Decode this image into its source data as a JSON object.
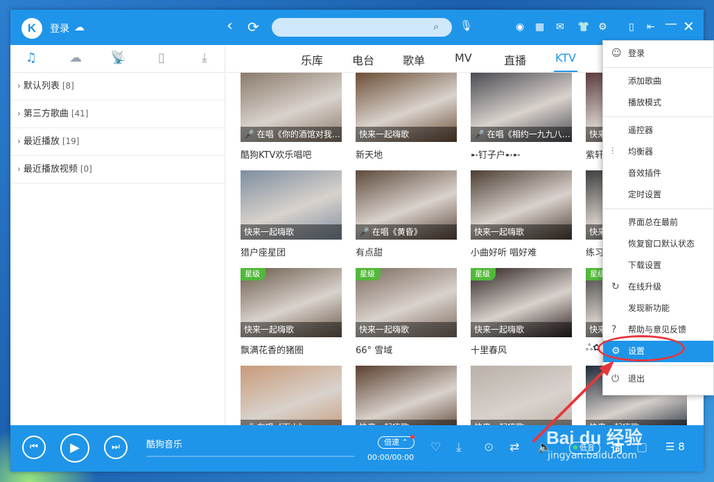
{
  "titlebar": {
    "logo_letter": "K",
    "login": "登录",
    "search": {
      "value": "",
      "placeholder": ""
    }
  },
  "sidebar": {
    "items": [
      {
        "label": "默认列表",
        "count": "[8]"
      },
      {
        "label": "第三方歌曲",
        "count": "[41]"
      },
      {
        "label": "最近播放",
        "count": "[19]"
      },
      {
        "label": "最近播放视频",
        "count": "[0]"
      }
    ]
  },
  "tabs": [
    {
      "label": "乐库"
    },
    {
      "label": "电台"
    },
    {
      "label": "歌单"
    },
    {
      "label": "MV"
    },
    {
      "label": "直播"
    },
    {
      "label": "KTV",
      "active": true
    }
  ],
  "cards": [
    {
      "overlay": "在唱《你的酒馆对我…",
      "mic": true,
      "title": "酷狗KTV欢乐唱吧",
      "star": "",
      "color": "#8a7a6a"
    },
    {
      "overlay": "快来一起嗨歌",
      "mic": false,
      "title": "新天地",
      "star": "",
      "color": "#6b4e36"
    },
    {
      "overlay": "在唱《相约一九九八…",
      "mic": true,
      "title": "➸钉子户➸➸",
      "star": "",
      "color": "#4a4a52"
    },
    {
      "overlay": "快来",
      "mic": false,
      "title": "紫轩",
      "star": "",
      "color": "#5a3a3a"
    },
    {
      "overlay": "快来一起嗨歌",
      "mic": false,
      "title": "猎户座星团",
      "star": "",
      "color": "#7d8ea0"
    },
    {
      "overlay": "在唱《黄昏》",
      "mic": true,
      "title": "有点甜",
      "star": "",
      "color": "#5e4a3c"
    },
    {
      "overlay": "快来一起嗨歌",
      "mic": false,
      "title": "小曲好听 唱好难",
      "star": "",
      "color": "#4c3f34"
    },
    {
      "overlay": "快来",
      "mic": false,
      "title": "练习",
      "star": "",
      "color": "#3d3d3d"
    },
    {
      "overlay": "快来一起嗨歌",
      "mic": false,
      "title": "飘满花香的猪圈",
      "star": "星级",
      "color": "#6a5a4a"
    },
    {
      "overlay": "快来一起嗨歌",
      "mic": false,
      "title": "66° 雪域",
      "star": "星级",
      "color": "#7c6a5e"
    },
    {
      "overlay": "快来一起嗨歌",
      "mic": false,
      "title": "十里春风",
      "star": "星级",
      "color": "#2a2020"
    },
    {
      "overlay": "快来",
      "mic": false,
      "title": "ஃ✿",
      "star": "星级",
      "color": "#3a3a3a"
    },
    {
      "overlay": "在唱《下山》",
      "mic": true,
      "title": "",
      "star": "",
      "color": "#c89a78"
    },
    {
      "overlay": "快来一起嗨歌",
      "mic": false,
      "title": "",
      "star": "",
      "color": "#5a4030"
    },
    {
      "overlay": "快来一起嗨歌",
      "mic": false,
      "title": "",
      "star": "",
      "color": "#b8b0a8"
    },
    {
      "overlay": "快来一起嗨歌",
      "mic": false,
      "title": "",
      "star": "",
      "color": "#1e2a3a"
    }
  ],
  "player": {
    "song": "酷狗音乐",
    "speed": "倍速",
    "time": "00:00/00:00",
    "progress": 0,
    "quality": "低音",
    "lyric": "词",
    "list_count": "8"
  },
  "menu": {
    "items": [
      {
        "label": "登录",
        "icon": "user-icon",
        "glyph": "☺",
        "sep_after": true
      },
      {
        "label": "添加歌曲",
        "icon": "",
        "glyph": ""
      },
      {
        "label": "播放模式",
        "icon": "",
        "glyph": "",
        "sep_after": true
      },
      {
        "label": "遥控器",
        "icon": "",
        "glyph": ""
      },
      {
        "label": "均衡器",
        "icon": "equalizer-icon",
        "glyph": "⫶"
      },
      {
        "label": "音效插件",
        "icon": "",
        "glyph": ""
      },
      {
        "label": "定时设置",
        "icon": "",
        "glyph": "",
        "sep_after": true
      },
      {
        "label": "界面总在最前",
        "icon": "",
        "glyph": ""
      },
      {
        "label": "恢复窗口默认状态",
        "icon": "",
        "glyph": ""
      },
      {
        "label": "下载设置",
        "icon": "",
        "glyph": ""
      },
      {
        "label": "在线升级",
        "icon": "upgrade-icon",
        "glyph": "↻"
      },
      {
        "label": "发现新功能",
        "icon": "",
        "glyph": ""
      },
      {
        "label": "帮助与意见反馈",
        "icon": "help-icon",
        "glyph": "?"
      },
      {
        "label": "设置",
        "icon": "settings-icon",
        "glyph": "⚙",
        "highlight": true,
        "sep_after": true
      },
      {
        "label": "退出",
        "icon": "power-icon",
        "glyph": "⏻"
      }
    ]
  },
  "watermark": {
    "main": "Bai du 经验",
    "sub": "jingyan.baidu.com"
  },
  "colors": {
    "accent": "#1f95e9",
    "star_badge": "#52b83a",
    "annotation": "#e8363c"
  }
}
